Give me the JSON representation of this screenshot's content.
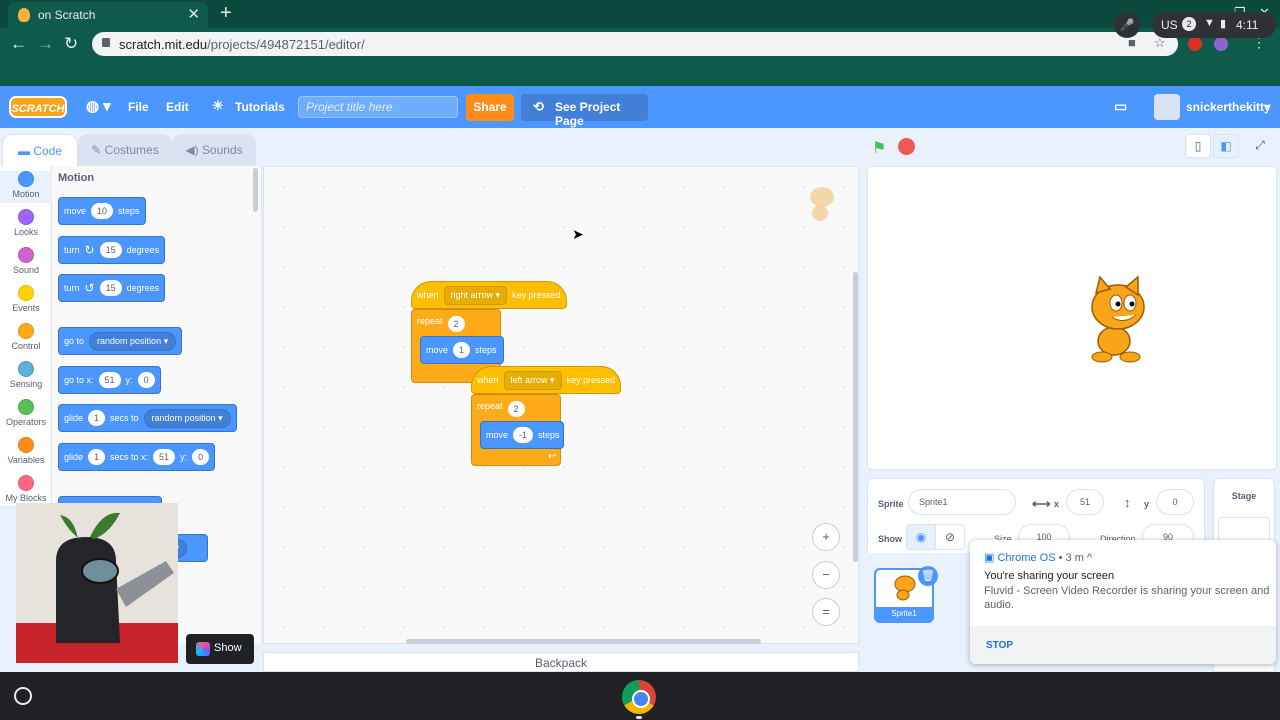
{
  "browser": {
    "tab_title": "on Scratch",
    "url_host": "scratch.mit.edu",
    "url_path": "/projects/494872151/editor/"
  },
  "menubar": {
    "logo": "SCRATCH",
    "file": "File",
    "edit": "Edit",
    "tutorials": "Tutorials",
    "project_title_placeholder": "Project title here",
    "share": "Share",
    "see_project_page": "See Project Page",
    "username": "snickerthekitty"
  },
  "tabs": {
    "code": "Code",
    "costumes": "Costumes",
    "sounds": "Sounds"
  },
  "categories": [
    {
      "label": "Motion",
      "color": "#4c97ff"
    },
    {
      "label": "Looks",
      "color": "#9966ff"
    },
    {
      "label": "Sound",
      "color": "#cf63cf"
    },
    {
      "label": "Events",
      "color": "#ffd500"
    },
    {
      "label": "Control",
      "color": "#ffab19"
    },
    {
      "label": "Sensing",
      "color": "#5cb1d6"
    },
    {
      "label": "Operators",
      "color": "#59c059"
    },
    {
      "label": "Variables",
      "color": "#ff8c1a"
    },
    {
      "label": "My Blocks",
      "color": "#ff6680"
    }
  ],
  "palette": {
    "title": "Motion",
    "move": {
      "a": "move",
      "v": "10",
      "b": "steps"
    },
    "turn_right": {
      "a": "turn",
      "v": "15",
      "b": "degrees"
    },
    "turn_left": {
      "a": "turn",
      "v": "15",
      "b": "degrees"
    },
    "goto": {
      "a": "go to",
      "opt": "random position"
    },
    "gotoxy": {
      "a": "go to x:",
      "x": "51",
      "y_lbl": "y:",
      "y": "0"
    },
    "glide_rand": {
      "a": "glide",
      "v": "1",
      "b": "secs to",
      "opt": "random position"
    },
    "glide_xy": {
      "a": "glide",
      "v": "1",
      "b": "secs to x:",
      "x": "51",
      "y_lbl": "y:",
      "y": "0"
    },
    "partial_dropdown": "er"
  },
  "scripts": [
    {
      "hat": {
        "when": "when",
        "key": "right arrow",
        "tail": "key pressed"
      },
      "repeat": {
        "label": "repeat",
        "count": "2"
      },
      "move": {
        "label": "move",
        "value": "1",
        "tail": "steps"
      }
    },
    {
      "hat": {
        "when": "when",
        "key": "left arrow",
        "tail": "key pressed"
      },
      "repeat": {
        "label": "repeat",
        "count": "2"
      },
      "move": {
        "label": "move",
        "value": "-1",
        "tail": "steps"
      }
    }
  ],
  "zoom": {
    "in": "+",
    "out": "−",
    "reset": "="
  },
  "backpack": "Backpack",
  "sprite_info": {
    "sprite_label": "Sprite",
    "sprite_name": "Sprite1",
    "x_label": "x",
    "x": "51",
    "y_label": "y",
    "y": "0",
    "show_label": "Show",
    "size_label": "Size",
    "size": "100",
    "direction_label": "Direction",
    "direction": "90"
  },
  "sprite_list": {
    "thumb_name": "Sprite1"
  },
  "stage_panel": {
    "title": "Stage"
  },
  "notification": {
    "source": "Chrome OS",
    "age": "3 m",
    "heading": "You're sharing your screen",
    "body": "Fluvid - Screen Video Recorder is sharing your screen and audio.",
    "action": "STOP"
  },
  "webcam": {
    "show_label": "Show"
  },
  "shelf": {
    "locale": "US",
    "notif_count": "2",
    "time": "4:11"
  }
}
